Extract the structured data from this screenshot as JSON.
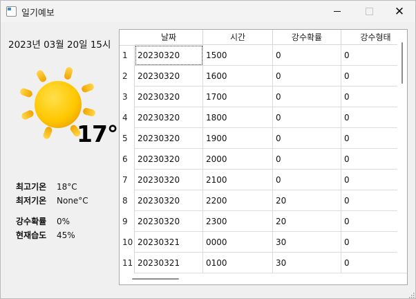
{
  "window": {
    "title": "일기예보"
  },
  "weather": {
    "datetime": "2023년 03월 20일 15시",
    "temperature": "17°",
    "icon": "sun-icon",
    "max_label": "최고기온",
    "max_value": "18°C",
    "min_label": "최저기온",
    "min_value": "None°C",
    "rain_prob_label": "강수확률",
    "rain_prob_value": "0%",
    "humidity_label": "현재습도",
    "humidity_value": "45%"
  },
  "table": {
    "columns": [
      "날짜",
      "시간",
      "강수확률",
      "강수형태"
    ],
    "rows": [
      {
        "num": "1",
        "date": "20230320",
        "time": "1500",
        "prob": "0",
        "type": "0"
      },
      {
        "num": "2",
        "date": "20230320",
        "time": "1600",
        "prob": "0",
        "type": "0"
      },
      {
        "num": "3",
        "date": "20230320",
        "time": "1700",
        "prob": "0",
        "type": "0"
      },
      {
        "num": "4",
        "date": "20230320",
        "time": "1800",
        "prob": "0",
        "type": "0"
      },
      {
        "num": "5",
        "date": "20230320",
        "time": "1900",
        "prob": "0",
        "type": "0"
      },
      {
        "num": "6",
        "date": "20230320",
        "time": "2000",
        "prob": "0",
        "type": "0"
      },
      {
        "num": "7",
        "date": "20230320",
        "time": "2100",
        "prob": "0",
        "type": "0"
      },
      {
        "num": "8",
        "date": "20230320",
        "time": "2200",
        "prob": "20",
        "type": "0"
      },
      {
        "num": "9",
        "date": "20230320",
        "time": "2300",
        "prob": "20",
        "type": "0"
      },
      {
        "num": "10",
        "date": "20230321",
        "time": "0000",
        "prob": "30",
        "type": "0"
      },
      {
        "num": "11",
        "date": "20230321",
        "time": "0100",
        "prob": "30",
        "type": "0"
      }
    ]
  }
}
